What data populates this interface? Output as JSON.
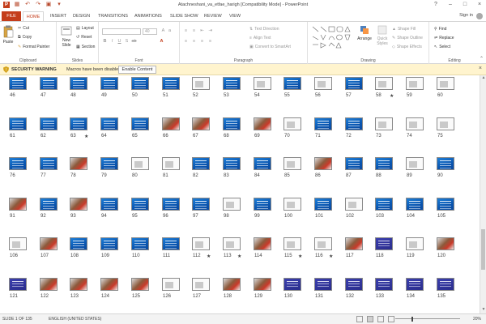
{
  "window": {
    "title": "Atachneshani_va_etfae_harigh [Compatibility Mode] - PowerPoint",
    "buttons": [
      "?",
      "–",
      "□",
      "×"
    ]
  },
  "tabs": {
    "file": "FILE",
    "items": [
      "HOME",
      "INSERT",
      "DESIGN",
      "TRANSITIONS",
      "ANIMATIONS",
      "SLIDE SHOW",
      "REVIEW",
      "VIEW"
    ],
    "signin": "Sign in"
  },
  "ribbon": {
    "clipboard": {
      "paste": "Paste",
      "cut": "Cut",
      "copy": "Copy",
      "format_painter": "Format Painter",
      "label": "Clipboard"
    },
    "slides": {
      "new_slide": "New Slide",
      "layout": "Layout",
      "reset": "Reset",
      "section": "Section",
      "label": "Slides"
    },
    "font": {
      "label": "Font",
      "size": "40"
    },
    "paragraph": {
      "text_direction": "Text Direction",
      "align_text": "Align Text",
      "convert": "Convert to SmartArt",
      "label": "Paragraph"
    },
    "drawing": {
      "arrange": "Arrange",
      "quick_styles": "Quick Styles",
      "shape_fill": "Shape Fill",
      "shape_outline": "Shape Outline",
      "shape_effects": "Shape Effects",
      "label": "Drawing"
    },
    "editing": {
      "find": "Find",
      "replace": "Replace",
      "select": "Select",
      "label": "Editing"
    }
  },
  "security": {
    "warning": "SECURITY WARNING",
    "message": "Macros have been disabled.",
    "button": "Enable Content"
  },
  "slides": {
    "rows": [
      [
        46,
        47,
        48,
        49,
        50,
        51,
        52,
        53,
        54,
        55,
        56,
        57,
        58,
        59,
        60
      ],
      [
        61,
        62,
        63,
        64,
        65,
        66,
        67,
        68,
        69,
        70,
        71,
        72,
        73,
        74,
        75
      ],
      [
        76,
        77,
        78,
        79,
        80,
        81,
        82,
        83,
        84,
        85,
        86,
        87,
        88,
        89,
        90
      ],
      [
        91,
        92,
        93,
        94,
        95,
        96,
        97,
        98,
        99,
        100,
        101,
        102,
        103,
        104,
        105
      ],
      [
        106,
        107,
        108,
        109,
        110,
        111,
        112,
        113,
        114,
        115,
        116,
        117,
        118,
        119,
        120
      ],
      [
        121,
        122,
        123,
        124,
        125,
        126,
        127,
        128,
        129,
        130,
        131,
        132,
        133,
        134,
        135
      ]
    ],
    "starred": [
      58,
      63,
      112,
      113,
      115,
      116
    ],
    "kinds": {
      "46": "blue",
      "47": "blue",
      "48": "blue",
      "49": "blue",
      "50": "blue",
      "51": "blue",
      "52": "white",
      "53": "blue",
      "54": "white",
      "55": "blue",
      "56": "white",
      "57": "blue",
      "58": "white",
      "59": "white",
      "60": "white",
      "61": "blue",
      "62": "blue",
      "63": "blue",
      "64": "blue",
      "65": "blue",
      "66": "photo",
      "67": "photo",
      "68": "blue",
      "69": "photo",
      "70": "white",
      "71": "blue",
      "72": "blue",
      "73": "white",
      "74": "white",
      "75": "white",
      "76": "blue",
      "77": "blue",
      "78": "photo",
      "79": "blue",
      "80": "white",
      "81": "white",
      "82": "blue",
      "83": "blue",
      "84": "blue",
      "85": "white",
      "86": "photo",
      "87": "blue",
      "88": "blue",
      "89": "white",
      "90": "blue",
      "91": "photo",
      "92": "blue",
      "93": "photo",
      "94": "blue",
      "95": "blue",
      "96": "blue",
      "97": "blue",
      "98": "white",
      "99": "blue",
      "100": "white",
      "101": "blue",
      "102": "white",
      "103": "blue",
      "104": "blue",
      "105": "blue",
      "106": "white",
      "107": "photo",
      "108": "blue",
      "109": "blue",
      "110": "blue",
      "111": "blue",
      "112": "white",
      "113": "white",
      "114": "photo",
      "115": "white",
      "116": "white",
      "117": "photo",
      "118": "purple",
      "119": "white",
      "120": "photo",
      "121": "purple",
      "122": "photo",
      "123": "photo",
      "124": "photo",
      "125": "photo",
      "126": "white",
      "127": "white",
      "128": "photo",
      "129": "photo",
      "130": "purple",
      "131": "purple",
      "132": "purple",
      "133": "purple",
      "134": "purple",
      "135": "purple"
    }
  },
  "status": {
    "slide_info": "SLIDE 1 OF 135",
    "language": "ENGLISH (UNITED STATES)",
    "zoom": "20%"
  },
  "colors": {
    "accent": "#c43e1c",
    "security_bg": "#fff4ce"
  }
}
